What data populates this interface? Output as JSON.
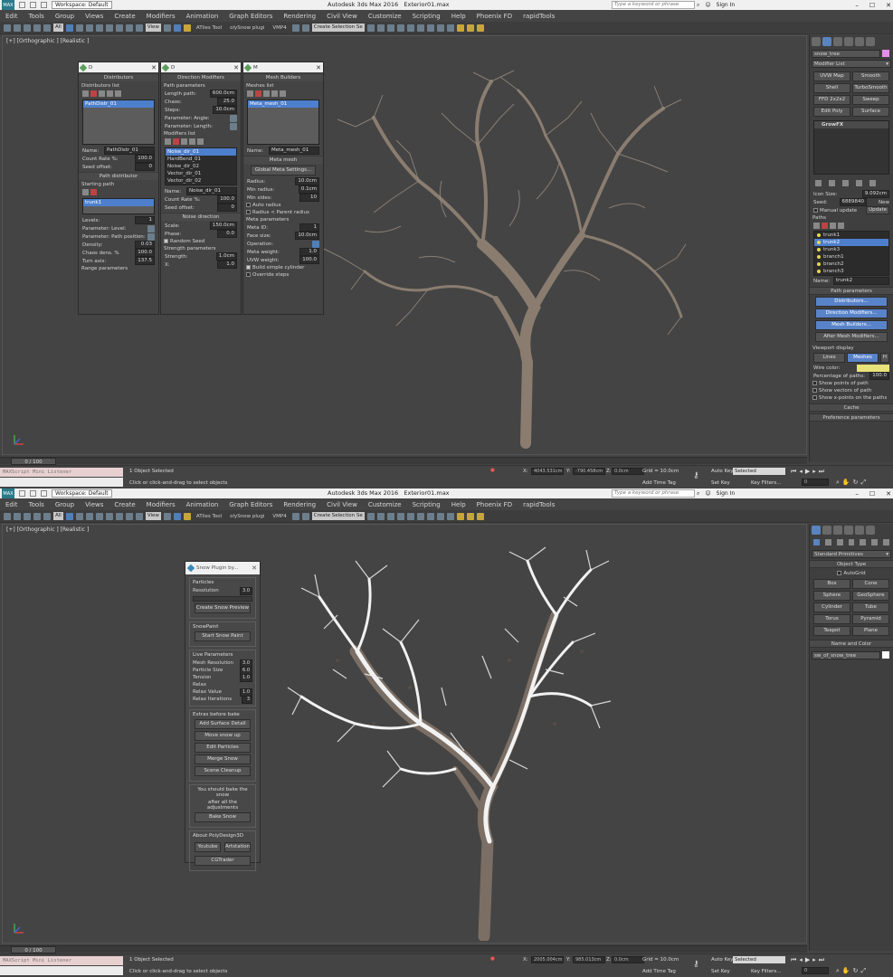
{
  "app": {
    "title": "Autodesk 3ds Max 2016",
    "file": "Exterior01.max",
    "workspace": "Workspace: Default",
    "search_placeholder": "Type a keyword or phrase",
    "sign_in": "Sign In"
  },
  "menu": [
    "Edit",
    "Tools",
    "Group",
    "Views",
    "Create",
    "Modifiers",
    "Animation",
    "Graph Editors",
    "Rendering",
    "Civil View",
    "Customize",
    "Scripting",
    "Help",
    "Phoenix FD",
    "rapidTools"
  ],
  "toolbar": {
    "filter": "All",
    "view": "View",
    "atiles": "ATiles Tool",
    "polysnow": "olySnow plugi",
    "vmp": "VMP4",
    "selset": "Create Selection Se"
  },
  "viewport": {
    "label": "[+] [Orthographic ] [Realistic ]"
  },
  "top": {
    "object_name": "snow_tree",
    "modifier_list": "Modifier List",
    "mod_buttons": [
      "UVW Map",
      "Smooth",
      "Shell",
      "TurboSmooth",
      "FFD 2x2x2",
      "Sweep",
      "Edit Poly",
      "Surface"
    ],
    "stack_item": "GrowFX",
    "icon_size_label": "Icon Size:",
    "icon_size": "9.092cm",
    "seed_label": "Seed:",
    "seed": "6889840",
    "new": "New",
    "manual_update": "Manual update",
    "update": "Update",
    "paths_label": "Paths",
    "paths": [
      "trunk1",
      "trunk2",
      "trunk3",
      "branch1",
      "branch2",
      "branch3"
    ],
    "name_label": "Name:",
    "name_value": "trunk2",
    "path_params": "Path parameters",
    "distributors": "Distributors...",
    "direction_mods": "Direction Modifiers...",
    "mesh_builders": "Mesh Builders...",
    "after_mesh": "After Mesh Modifiers...",
    "viewport_display": "Viewport display",
    "lines": "Lines",
    "meshes": "Meshes",
    "h": "H",
    "wire_color": "Wire color:",
    "pct_paths": "Percentage of paths:",
    "pct_val": "100.0",
    "show_points": "Show points of path",
    "show_vectors": "Show vectors of path",
    "show_xpoints": "Show x-points on the paths",
    "cache": "Cache",
    "pref_params": "Preference parameters",
    "w1": {
      "title": "D",
      "roll1": "Distributors",
      "dlist": "Distributors list",
      "ditem": "PathDistr_01",
      "name_label": "Name:",
      "name_val": "PathDistr_01",
      "count_rate": "Count Rate %:",
      "count_val": "100.0",
      "seed_offset": "Seed offset:",
      "seed_val": "0",
      "roll2": "Path distributor",
      "starting_path": "Starting path",
      "sp_item": "trunk1",
      "levels": "Levels:",
      "levels_val": "1",
      "p_level": "Parameter: Level:",
      "p_pathpos": "Parameter: Path position:",
      "density": "Density:",
      "density_val": "0.03",
      "chaos_dens": "Chaos dens. %",
      "chaos_dens_val": "100.0",
      "turn_axis": "Turn axis:",
      "turn_val": "137.5",
      "range": "Range parameters"
    },
    "w2": {
      "title": "D",
      "roll1": "Direction Modifiers",
      "pp": "Path parameters",
      "length": "Length path:",
      "length_val": "600.0cm",
      "chaos": "Chaos:",
      "chaos_val": "25.0",
      "steps": "Steps:",
      "steps_val": "10.0cm",
      "angle": "Parameter: Angle:",
      "plength": "Parameter: Length:",
      "modlist": "Modifiers list",
      "mods": [
        "Noise_dir_01",
        "HardBend_01",
        "Noise_dir_02",
        "Vector_dir_01",
        "Vector_dir_02"
      ],
      "name_label": "Name:",
      "name_val": "Noise_dir_01",
      "count_rate": "Count Rate %:",
      "count_val": "100.0",
      "seed_offset": "Seed offset:",
      "seed_val": "0",
      "roll2": "Noise direction",
      "scale": "Scale:",
      "scale_val": "150.0cm",
      "phase": "Phase:",
      "phase_val": "0.0",
      "random_seed": "Random Seed",
      "strength_params": "Strength parameters",
      "strength": "Strength:",
      "strength_val": "1.0cm",
      "x": "X:",
      "x_val": "1.0"
    },
    "w3": {
      "title": "M",
      "roll1": "Mesh Builders",
      "mlist": "Meshes list",
      "mitem": "Meta_mesh_01",
      "name_label": "Name:",
      "name_val": "Meta_mesh_01",
      "roll2": "Meta mesh",
      "global": "Global Meta Settings...",
      "radius": "Radius:",
      "radius_val": "10.0cm",
      "min_radius": "Min radius:",
      "min_radius_val": "0.1cm",
      "min_sides": "Min sides:",
      "min_sides_val": "10",
      "auto_radius": "Auto radius",
      "radius_parent": "Radius < Parent radius",
      "meta_params": "Meta parameters",
      "meta_id": "Meta ID:",
      "meta_id_val": "1",
      "face_size": "Face size:",
      "face_size_val": "10.0cm",
      "operation": "Operation:",
      "meta_weight": "Meta weight:",
      "meta_weight_val": "1.0",
      "uvw_weight": "UVW weight:",
      "uvw_weight_val": "100.0",
      "build_simple": "Build simple cylinder",
      "override": "Override steps"
    }
  },
  "bottom": {
    "std_prims": "Standard Primitives",
    "object_type": "Object Type",
    "autogrid": "AutoGrid",
    "prims": [
      "Box",
      "Cone",
      "Sphere",
      "GeoSphere",
      "Cylinder",
      "Tube",
      "Torus",
      "Pyramid",
      "Teapot",
      "Plane"
    ],
    "name_color": "Name and Color",
    "object_name": "sw_of_snow_tree",
    "snow": {
      "title": "Snow Plugin by...",
      "particles": "Particles",
      "resolution": "Resolution",
      "resolution_val": "3.0",
      "create_preview": "Create Snow Preview",
      "snowpaint": "SnowPaint",
      "start_paint": "Start Snow Paint",
      "live": "Live Parameters",
      "mesh_res": "Mesh Resolution",
      "mesh_res_val": "3.0",
      "particle_size": "Particle Size",
      "particle_size_val": "6.0",
      "tension": "Tension",
      "tension_val": "1.0",
      "relax": "Relax",
      "relax_value": "Relax Value",
      "relax_value_val": "1.0",
      "relax_iter": "Relax Iterations",
      "relax_iter_val": "3",
      "extras": "Extras before bake",
      "add_detail": "Add Surface Detail",
      "move_up": "Move snow up",
      "edit_particles": "Edit Particles",
      "merge": "Merge Snow",
      "cleanup": "Scene Cleanup",
      "note1": "You should bake the snow",
      "note2": "after all the adjustments",
      "bake": "Bake Snow",
      "about": "About PolyDesign3D",
      "youtube": "Youtube",
      "artstation": "Artstation",
      "cgtrader": "CGTrader"
    }
  },
  "timeline": {
    "frame": "0 / 100"
  },
  "status": {
    "maxscript": "MAXScript Mini Listener",
    "selected": "1 Object Selected",
    "prompt": "Click or click-and-drag to select objects",
    "x_top": "4043.531cm",
    "y_top": "-790.458cm",
    "z_top": "0.0cm",
    "x_bot": "2005.004cm",
    "y_bot": "985.013cm",
    "z_bot": "0.0cm",
    "grid": "Grid = 10.0cm",
    "add_time_tag": "Add Time Tag",
    "auto_key": "Auto Key",
    "set_key": "Set Key",
    "key_sel": "Selected",
    "key_filters": "Key Filters...",
    "frame_val": "0"
  }
}
